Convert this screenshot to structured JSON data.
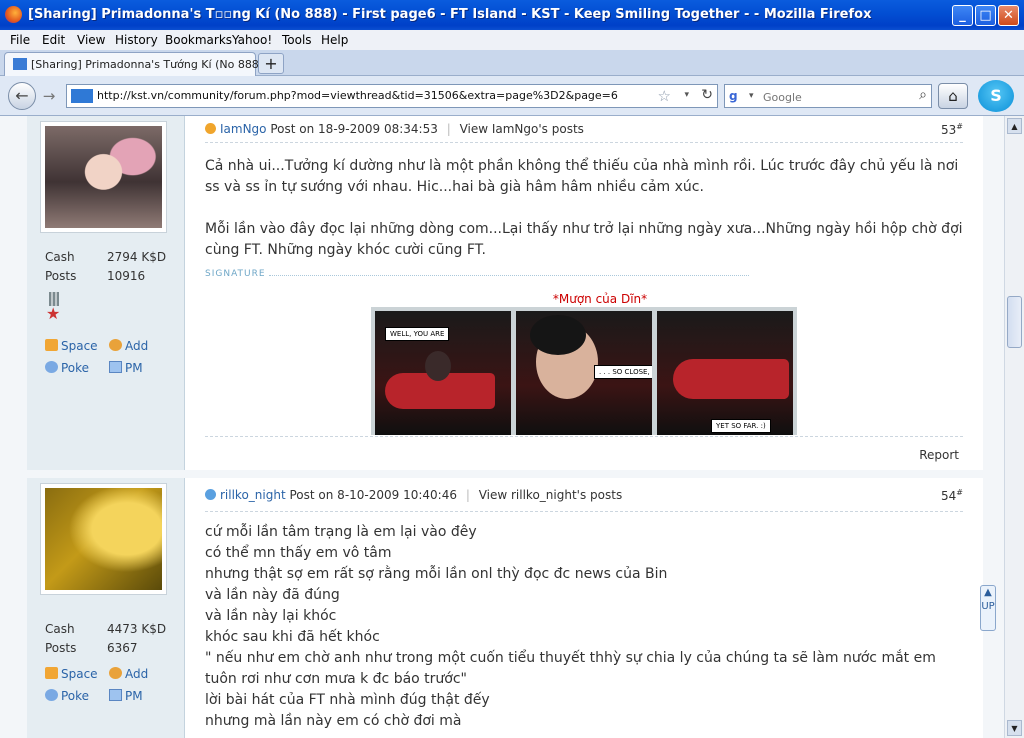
{
  "window": {
    "title": "[Sharing] Primadonna's T▫▫ng Kí (No 888) - First page6 - FT Island - KST - Keep Smiling Together - - Mozilla Firefox",
    "btn_min": "_",
    "btn_max": "□",
    "btn_close": "✕"
  },
  "menu": [
    "File",
    "Edit",
    "View",
    "History",
    "Bookmarks",
    "Yahoo!",
    "Tools",
    "Help"
  ],
  "tab": {
    "label": "[Sharing] Primadonna's Tướng Kí (No 888) - ...",
    "new_tab": "+"
  },
  "nav": {
    "back": "←",
    "forward": "→",
    "url": "http://kst.vn/community/forum.php?mod=viewthread&tid=31506&extra=page%3D2&page=6",
    "star": "☆",
    "dropdown": "▾",
    "reload": "↻",
    "search_engine": "g",
    "search_placeholder": "Google",
    "search_icon": "⌕",
    "home": "⌂",
    "skype": "S"
  },
  "posts": [
    {
      "stats": [
        {
          "label": "Cash",
          "value": "2794 K$D"
        },
        {
          "label": "Posts",
          "value": "10916"
        }
      ],
      "actions": {
        "space": "Space",
        "add": "Add",
        "poke": "Poke",
        "pm": "PM"
      },
      "author": "IamNgo",
      "posted": "Post on 18-9-2009 08:34:53",
      "sep": "|",
      "view_link": "View IamNgo's posts",
      "number": "53",
      "number_mark": "#",
      "message": [
        "Cả nhà ui...Tưởng kí dường như là một phần không thể thiếu của nhà mình rồi. Lúc trước đây chủ yếu là nơi ss và ss ỉn tự sướng với nhau. Hic...hai bà già hâm hâm nhiều cảm xúc.",
        "",
        "Mỗi lần vào đây đọc lại những dòng com...Lại thấy như trở lại những ngày xưa...Những ngày hồi hộp chờ đợi cùng FT. Những ngày khóc cười cũng FT."
      ],
      "signature_label": "SIGNATURE",
      "signature_title": "*Mượn của Dĩn*",
      "signature_captions": [
        "WELL, YOU ARE",
        ". . . SO CLOSE,",
        "YET SO FAR. :)"
      ],
      "report": "Report"
    },
    {
      "stats": [
        {
          "label": "Cash",
          "value": "4473 K$D"
        },
        {
          "label": "Posts",
          "value": "6367"
        }
      ],
      "actions": {
        "space": "Space",
        "add": "Add",
        "poke": "Poke",
        "pm": "PM"
      },
      "author": "rillko_night",
      "posted": "Post on 8-10-2009 10:40:46",
      "sep": "|",
      "view_link": "View rillko_night's posts",
      "number": "54",
      "number_mark": "#",
      "message": [
        "cứ mỗi lần tâm trạng là em lại vào đêy",
        "có thể mn thấy em vô tâm",
        "nhưng thật sợ em rất sợ rằng mỗi lần onl thỳ đọc đc news của Bin",
        "và lần này đã đúng",
        "và lần này lại khóc",
        "khóc sau khi đã hết khóc",
        "\" nếu như em chờ anh như trong một cuốn tiểu thuyết thhỳ sự chia ly của chúng ta sẽ làm nước mắt em tuôn rơi như cơn mưa k đc báo trước\"",
        "lời bài hát của FT nhà mình đúg thật đếy",
        "nhưng mà lần này em có chờ đơi mà"
      ]
    }
  ],
  "scroll": {
    "up": "▲",
    "down": "▼",
    "up_button": "UP"
  }
}
